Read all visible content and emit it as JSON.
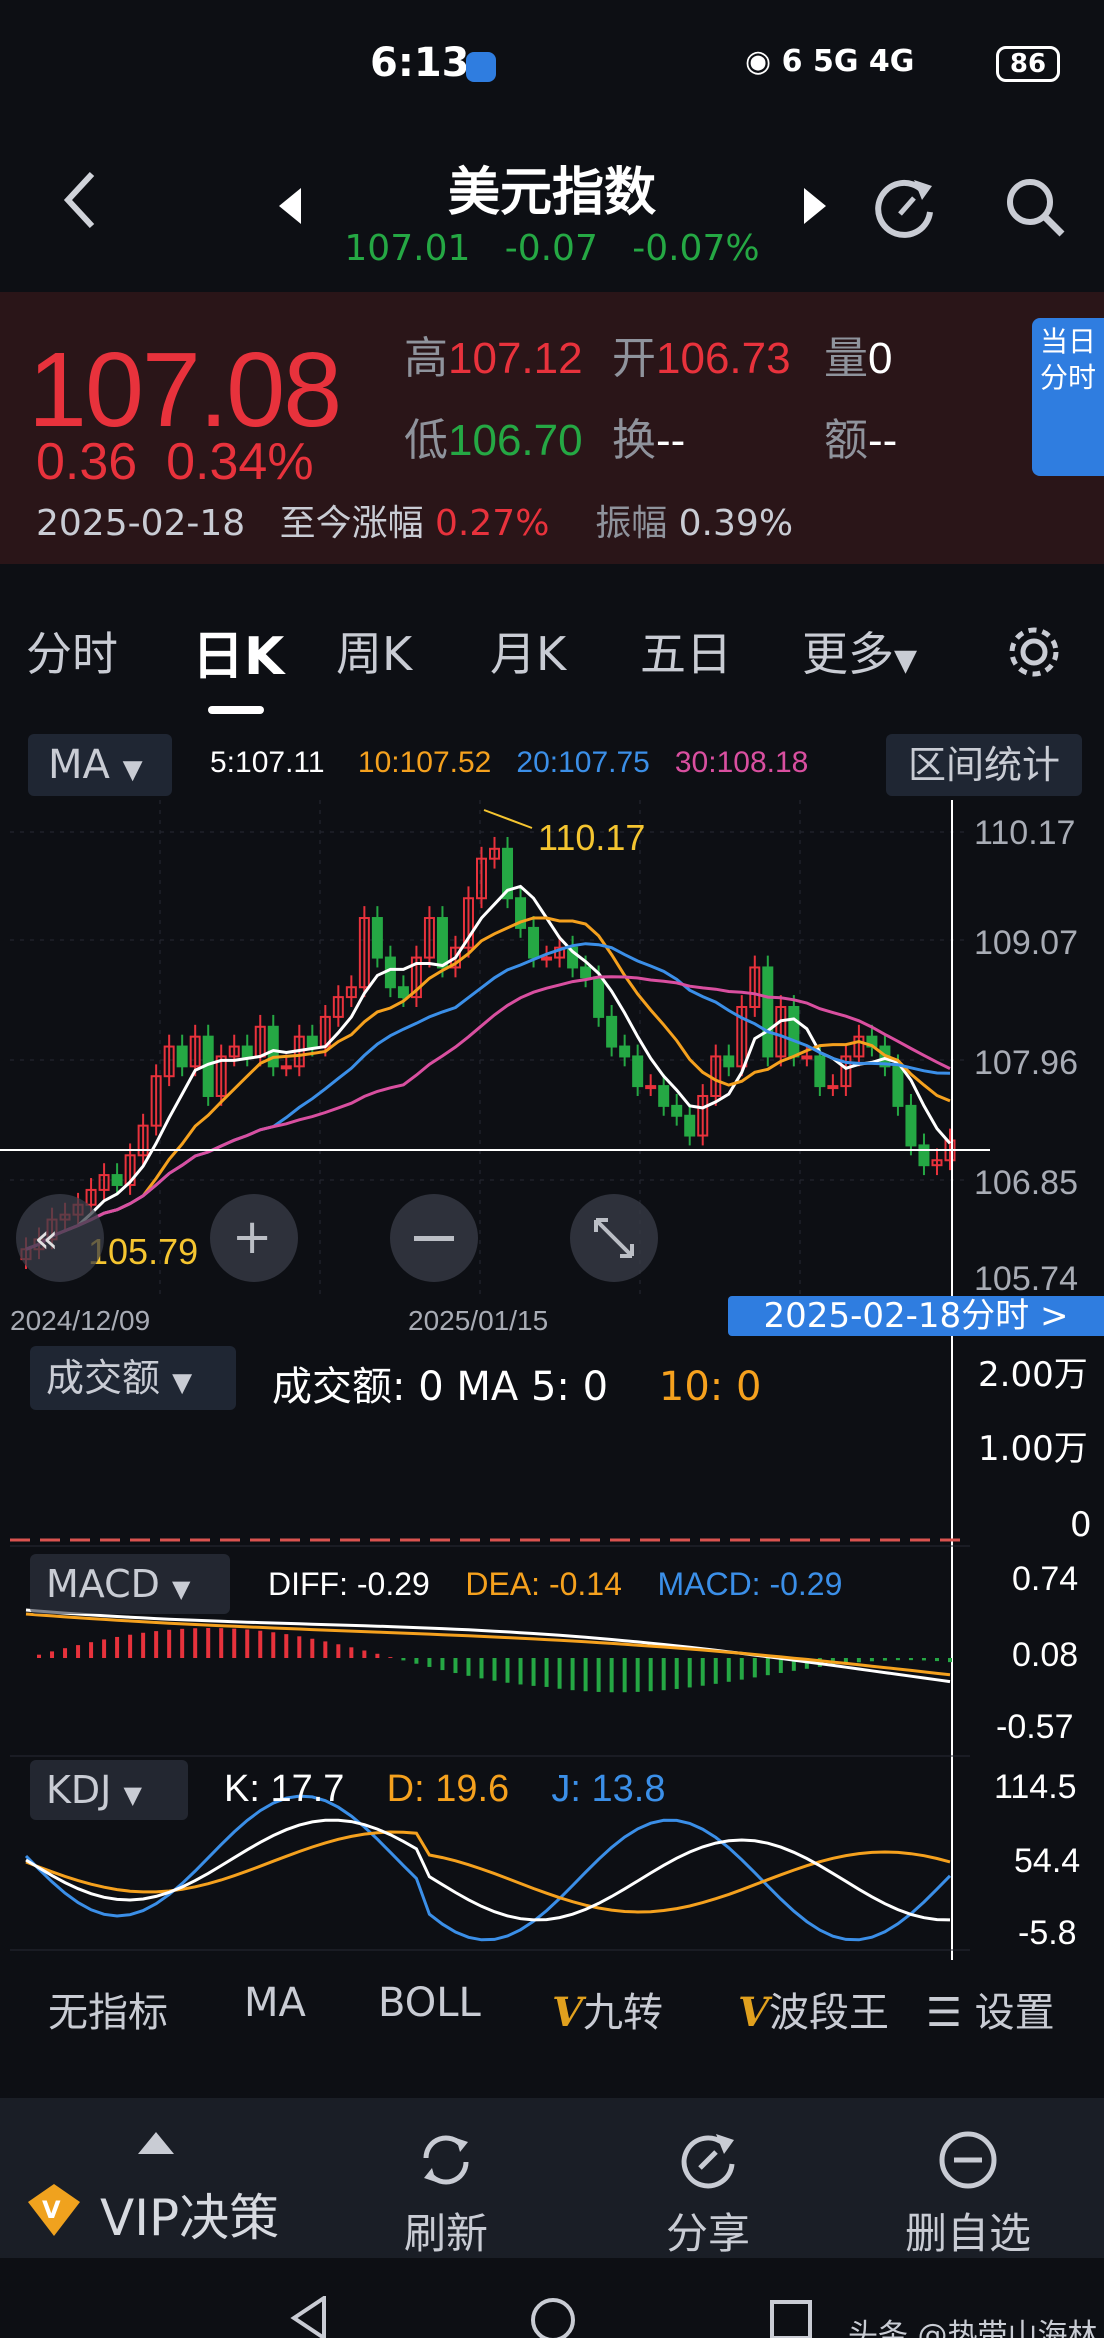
{
  "status": {
    "time": "6:13",
    "signals": "6 5G 4G",
    "battery": "86"
  },
  "header": {
    "title": "美元指数",
    "last": "107.01",
    "change": "-0.07",
    "change_pct": "-0.07%"
  },
  "quote": {
    "price": "107.08",
    "change": "0.36",
    "change_pct": "0.34%",
    "date": "2025-02-18",
    "ytd_label": "至今涨幅",
    "ytd_value": "0.27%",
    "amp_label": "振幅",
    "amp_value": "0.39%",
    "high_label": "高",
    "high": "107.12",
    "open_label": "开",
    "open": "106.73",
    "vol_label": "量",
    "vol": "0",
    "low_label": "低",
    "low": "106.70",
    "turn_label": "换",
    "turn": "--",
    "amount_label": "额",
    "amount": "--",
    "today_badge": "当日分时"
  },
  "tabs": [
    "分时",
    "日K",
    "周K",
    "月K",
    "五日",
    "更多"
  ],
  "active_tab": "日K",
  "ma": {
    "select": "MA",
    "ma5": "5:107.11",
    "ma10": "10:107.52",
    "ma20": "20:107.75",
    "ma30": "30:108.18",
    "range_btn": "区间统计"
  },
  "price_axis": [
    "110.17",
    "109.07",
    "107.96",
    "106.85",
    "105.74"
  ],
  "max_label": "110.17",
  "min_label": "105.79",
  "date_axis": [
    "2024/12/09",
    "2025/01/15"
  ],
  "date_badge": "2025-02-18分时  >",
  "volume": {
    "select": "成交额",
    "values": "成交额: 0   MA 5: 0",
    "ma10": "10: 0",
    "axis": [
      "2.00万",
      "1.00万",
      "0"
    ]
  },
  "macd": {
    "select": "MACD",
    "diff": "DIFF: -0.29",
    "dea": "DEA: -0.14",
    "macd": "MACD: -0.29",
    "axis": [
      "0.74",
      "0.08",
      "-0.57"
    ]
  },
  "kdj": {
    "select": "KDJ",
    "k": "K: 17.7",
    "d": "D: 19.6",
    "j": "J: 13.8",
    "axis": [
      "114.5",
      "54.4",
      "-5.8"
    ]
  },
  "indicator_tabs": {
    "none": "无指标",
    "ma": "MA",
    "boll": "BOLL",
    "nine": "九转",
    "wave": "波段王",
    "settings": "设置"
  },
  "bottom_nav": {
    "vip": "VIP决策",
    "refresh": "刷新",
    "share": "分享",
    "remove": "删自选"
  },
  "watermark": "头条 @热带山海林",
  "colors": {
    "up": "#e8323c",
    "down": "#25a844",
    "ma5": "#ffffff",
    "ma10": "#f5a11e",
    "ma20": "#3b8fe8",
    "ma30": "#d94fa0",
    "accent": "#2f7de0"
  },
  "chart_data": {
    "type": "candlestick",
    "price_range": [
      105.74,
      110.17
    ],
    "date_labels": [
      "2024/12/09",
      "2025/01/15"
    ],
    "ma_legend": [
      "5:107.11",
      "10:107.52",
      "20:107.75",
      "30:108.18"
    ],
    "annotations": {
      "high": 110.17,
      "low": 105.79
    }
  }
}
